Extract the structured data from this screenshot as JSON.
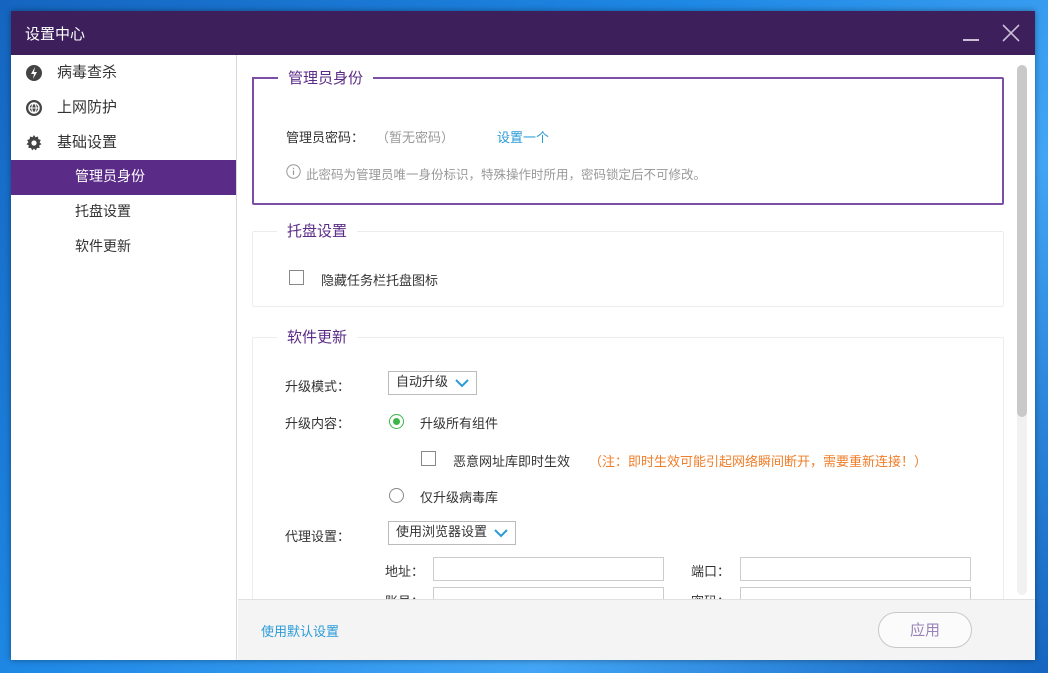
{
  "window": {
    "title": "设置中心"
  },
  "sidebar": {
    "categories": [
      {
        "label": "病毒查杀",
        "icon": "virus-scan-icon"
      },
      {
        "label": "上网防护",
        "icon": "web-protection-icon"
      },
      {
        "label": "基础设置",
        "icon": "gear-icon"
      }
    ],
    "subitems": [
      {
        "label": "管理员身份",
        "active": true
      },
      {
        "label": "托盘设置",
        "active": false
      },
      {
        "label": "软件更新",
        "active": false
      }
    ]
  },
  "admin": {
    "title": "管理员身份",
    "password_label": "管理员密码：",
    "password_value": "（暂无密码）",
    "set_link": "设置一个",
    "hint": "此密码为管理员唯一身份标识，特殊操作时所用，密码锁定后不可修改。"
  },
  "tray": {
    "title": "托盘设置",
    "hide_icon_label": "隐藏任务栏托盘图标",
    "hide_icon_checked": false
  },
  "update": {
    "title": "软件更新",
    "mode_label": "升级模式：",
    "mode_value": "自动升级",
    "content_label": "升级内容：",
    "option_all": "升级所有组件",
    "option_all_checked": true,
    "malicious_label": "恶意网址库即时生效",
    "malicious_checked": false,
    "malicious_note": "（注：即时生效可能引起网络瞬间断开，需要重新连接！）",
    "option_virus": "仅升级病毒库",
    "option_virus_checked": false,
    "proxy_label": "代理设置：",
    "proxy_value": "使用浏览器设置",
    "address_label": "地址：",
    "port_label": "端口：",
    "account_label": "账号：",
    "password_label": "密码：",
    "address_value": "",
    "port_value": "",
    "account_value": "",
    "password_value": ""
  },
  "footer": {
    "default_link": "使用默认设置",
    "apply_label": "应用"
  },
  "colors": {
    "titlebar": "#3d1f5c",
    "accent": "#5b2c87",
    "link": "#2a9bd8",
    "warning": "#f07d28",
    "radio_checked": "#3bb54a"
  }
}
